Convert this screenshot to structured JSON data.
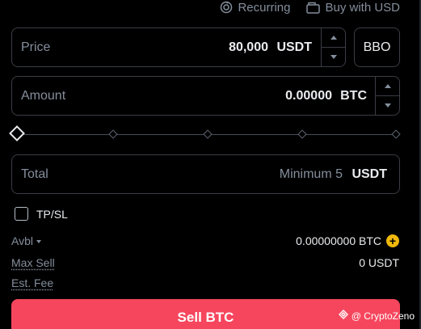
{
  "top_links": {
    "recurring": "Recurring",
    "buy_with": "Buy with USD"
  },
  "price": {
    "label": "Price",
    "value": "80,000",
    "unit": "USDT"
  },
  "bbo_label": "BBO",
  "amount": {
    "label": "Amount",
    "value": "0.00000",
    "unit": "BTC"
  },
  "slider": {
    "percent": 0,
    "marks": [
      0,
      25,
      50,
      75,
      100
    ]
  },
  "total": {
    "label": "Total",
    "placeholder": "Minimum 5",
    "unit": "USDT"
  },
  "tpsl": {
    "label": "TP/SL",
    "checked": false
  },
  "info": {
    "avbl_label": "Avbl",
    "avbl_value": "0.00000000 BTC",
    "max_sell_label": "Max Sell",
    "max_sell_value": "0 USDT",
    "est_fee_label": "Est. Fee"
  },
  "sell_button": "Sell BTC",
  "watermark": "@ CryptoZeno",
  "colors": {
    "sell": "#f6465d",
    "accent": "#f0b90b",
    "border": "#3a3d44",
    "muted": "#848e9c"
  }
}
